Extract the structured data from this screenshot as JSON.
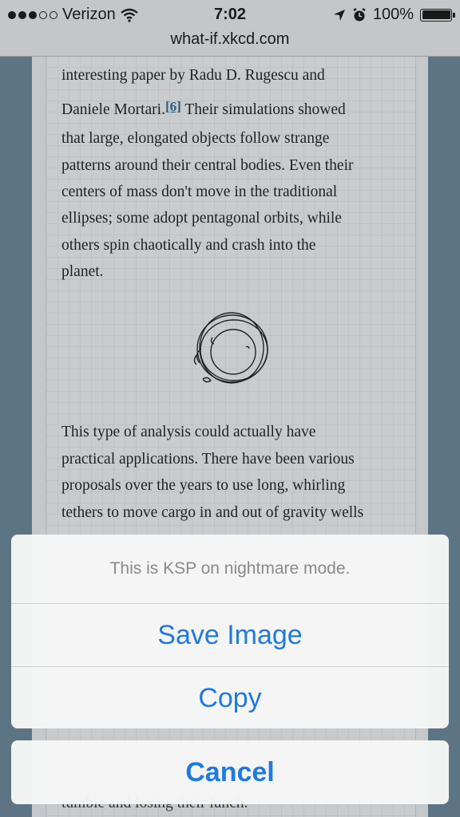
{
  "status": {
    "carrier": "Verizon",
    "time": "7:02",
    "battery": "100%",
    "signal_bars_filled": 3,
    "signal_bars_total": 5
  },
  "url": "what-if.xkcd.com",
  "article": {
    "para1": [
      "interesting paper by Radu D. Rugescu and",
      "Daniele Mortari.",
      "Their simulations showed",
      "that large, elongated objects follow strange",
      "patterns around their central bodies. Even their",
      "centers of mass don't move in the traditional",
      "ellipses; some adopt pentagonal orbits, while",
      "others spin chaotically and crash into the",
      "planet."
    ],
    "ref": "[6]",
    "para2": [
      "This type of analysis could actually have",
      "practical applications. There have been various",
      "proposals over the years to use long, whirling",
      "tethers to move cargo in and out of gravity wells"
    ],
    "bottom_peek": "tumble and losing their lunch."
  },
  "action_sheet": {
    "title": "This is KSP on nightmare mode.",
    "save_label": "Save Image",
    "copy_label": "Copy",
    "cancel_label": "Cancel"
  },
  "colors": {
    "accent": "#1f7ae0",
    "sidebar": "#5d7484"
  }
}
